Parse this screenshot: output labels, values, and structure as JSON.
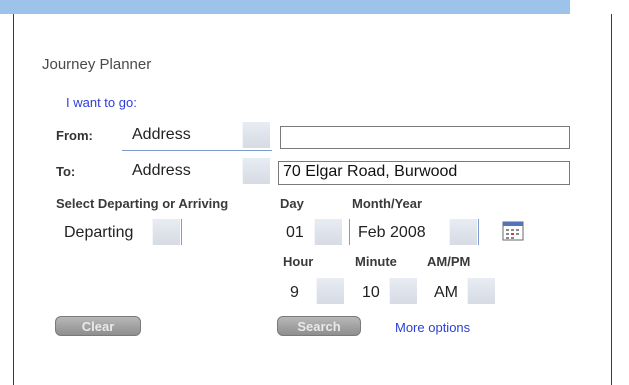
{
  "title": "Journey Planner",
  "subtitle": "I want to go:",
  "from": {
    "label": "From:",
    "type": "Address",
    "value": ""
  },
  "to": {
    "label": "To:",
    "type": "Address",
    "value": "70 Elgar Road, Burwood"
  },
  "mode": {
    "label": "Select Departing or Arriving",
    "value": "Departing"
  },
  "date": {
    "day_label": "Day",
    "day": "01",
    "monthyear_label": "Month/Year",
    "monthyear": "Feb 2008"
  },
  "time": {
    "hour_label": "Hour",
    "hour": "9",
    "minute_label": "Minute",
    "minute": "10",
    "ampm_label": "AM/PM",
    "ampm": "AM"
  },
  "buttons": {
    "clear": "Clear",
    "search": "Search"
  },
  "more_options": "More options",
  "icons": {
    "calendar": "calendar-icon"
  }
}
